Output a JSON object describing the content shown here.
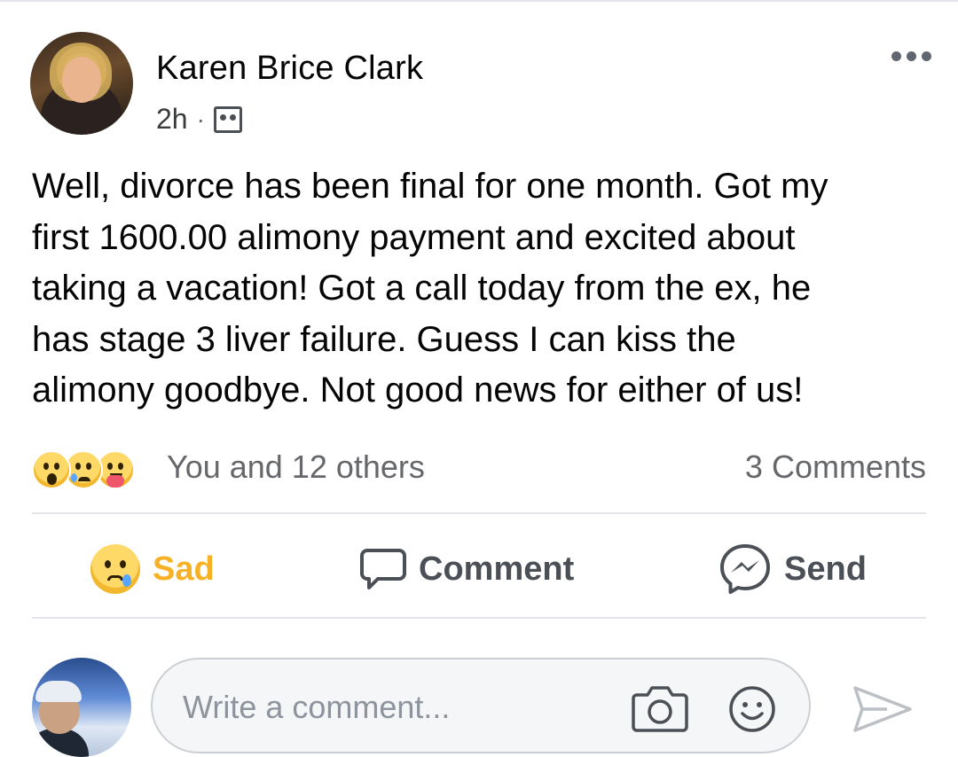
{
  "post": {
    "author": "Karen Brice Clark",
    "time": "2h",
    "separator": "·",
    "audience_icon": "friends-icon",
    "more_icon": "more-options-icon",
    "text": "Well, divorce has been final for one month.  Got my\nfirst 1600.00 alimony payment and excited about\ntaking a vacation!  Got a call today from the ex, he\nhas stage 3 liver failure.  Guess I can kiss the\nalimony goodbye.  Not good news for either of us!"
  },
  "reactions": {
    "icons": [
      "wow-reaction-icon",
      "sad-reaction-icon",
      "care-reaction-icon"
    ],
    "summary": "You and 12 others",
    "comments": "3 Comments"
  },
  "actions": {
    "sad_label": "Sad",
    "comment_label": "Comment",
    "send_label": "Send"
  },
  "composer": {
    "placeholder": "Write a comment..."
  },
  "colors": {
    "sad_accent": "#f7b125",
    "text": "#050505",
    "muted": "#65676b",
    "divider": "#e4e6eb"
  }
}
